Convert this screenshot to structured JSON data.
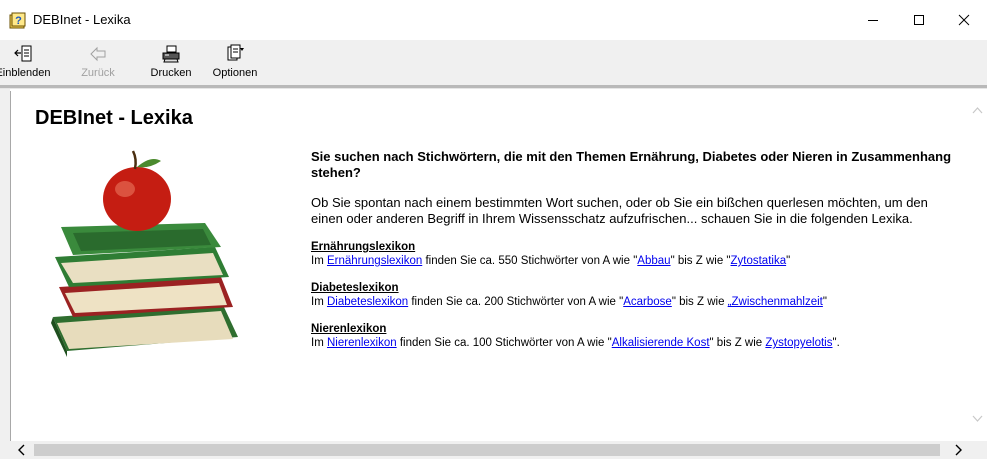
{
  "window": {
    "title": "DEBInet - Lexika",
    "controls": {
      "minimize": "minimize",
      "maximize": "maximize",
      "close": "close"
    }
  },
  "toolbar": {
    "einblenden": {
      "label": "Einblenden",
      "icon": "show-pane-icon"
    },
    "zurueck": {
      "label": "Zurück",
      "icon": "back-arrow-icon",
      "disabled": true
    },
    "drucken": {
      "label": "Drucken",
      "icon": "printer-icon"
    },
    "optionen": {
      "label": "Optionen",
      "icon": "options-icon"
    }
  },
  "page": {
    "title": "DEBInet - Lexika",
    "illustration": "apple-on-books",
    "intro_question": "Sie suchen nach Stichwörtern, die mit den Themen Ernährung, Diabetes oder Nieren in Zusammenhang stehen?",
    "intro_text": "Ob Sie spontan nach einem bestimmten Wort suchen, oder ob Sie ein bißchen querlesen möchten, um den einen oder anderen Begriff in Ihrem Wissensschatz aufzufrischen... schauen Sie in die folgenden Lexika."
  },
  "lexika": [
    {
      "heading": "Ernährungslexikon",
      "prefix": "Im ",
      "link": "Ernährungslexikon",
      "middle": " finden Sie ca. 550 Stichwörter von A wie \"",
      "first_term": "Abbau",
      "between": "\" bis Z wie \"",
      "last_term": "Zytostatika",
      "suffix": "\""
    },
    {
      "heading": "Diabeteslexikon",
      "prefix": "Im ",
      "link": "Diabeteslexikon",
      "middle": " finden Sie ca. 200 Stichwörter von A wie \"",
      "first_term": "Acarbose",
      "between": "\" bis Z wie ",
      "last_term": "„Zwischenmahlzeit",
      "suffix": "\""
    },
    {
      "heading": "Nierenlexikon",
      "prefix": "Im ",
      "link": "Nierenlexikon",
      "middle": " finden Sie ca. 100 Stichwörter von A wie \"",
      "first_term": "Alkalisierende Kost",
      "between": "\" bis Z wie ",
      "last_term": "Zystopyelotis",
      "suffix": "\"."
    }
  ],
  "colors": {
    "link": "#0000ee",
    "toolbar_bg": "#f0f0f0",
    "scroll_thumb": "#cdcdcd"
  }
}
